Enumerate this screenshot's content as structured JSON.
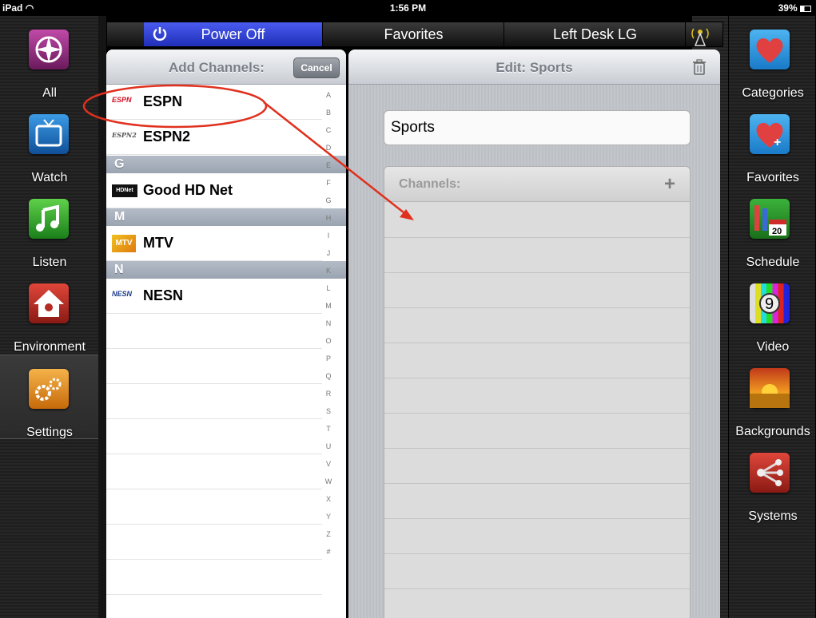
{
  "status_bar": {
    "device": "iPad",
    "time": "1:56 PM",
    "battery": "39%"
  },
  "left_nav": [
    {
      "label": "All",
      "icon": "compass-icon",
      "color": "#8a2a7a"
    },
    {
      "label": "Watch",
      "icon": "tv-icon",
      "color": "#1b6fb8"
    },
    {
      "label": "Listen",
      "icon": "music-note-icon",
      "color": "#2aa12a"
    },
    {
      "label": "Environment",
      "icon": "house-icon",
      "color": "#b52a22"
    },
    {
      "label": "Settings",
      "icon": "gears-icon",
      "color": "#e08a1a"
    }
  ],
  "right_nav": [
    {
      "label": "Categories",
      "icon": "heart-icon"
    },
    {
      "label": "Favorites",
      "icon": "heart-plus-icon"
    },
    {
      "label": "Schedule",
      "icon": "calendar-icon",
      "badge": "20"
    },
    {
      "label": "Video",
      "icon": "test-pattern-icon",
      "badge": "9"
    },
    {
      "label": "Backgrounds",
      "icon": "sunset-icon"
    },
    {
      "label": "Systems",
      "icon": "share-network-icon"
    }
  ],
  "top_tabs": {
    "power": "Power Off",
    "favorites": "Favorites",
    "device": "Left Desk LG"
  },
  "add_panel": {
    "title": "Add Channels:",
    "cancel": "Cancel",
    "channels": [
      {
        "name": "ESPN",
        "logo": "ESPN"
      },
      {
        "name": "ESPN2",
        "logo": "ESPN2"
      }
    ],
    "sections": [
      {
        "letter": "G",
        "channels": [
          {
            "name": "Good HD Net",
            "logo": "HDNet"
          }
        ]
      },
      {
        "letter": "M",
        "channels": [
          {
            "name": "MTV",
            "logo": "MTV"
          }
        ]
      },
      {
        "letter": "N",
        "channels": [
          {
            "name": "NESN",
            "logo": "NESN"
          }
        ]
      }
    ],
    "index": [
      "A",
      "B",
      "C",
      "D",
      "E",
      "F",
      "G",
      "H",
      "I",
      "J",
      "K",
      "L",
      "M",
      "N",
      "O",
      "P",
      "Q",
      "R",
      "S",
      "T",
      "U",
      "V",
      "W",
      "X",
      "Y",
      "Z",
      "#"
    ]
  },
  "edit_panel": {
    "title": "Edit: Sports",
    "name_value": "Sports",
    "channels_label": "Channels:"
  },
  "colors": {
    "power_tab": "#3346d6",
    "annotation": "#e0301e"
  }
}
